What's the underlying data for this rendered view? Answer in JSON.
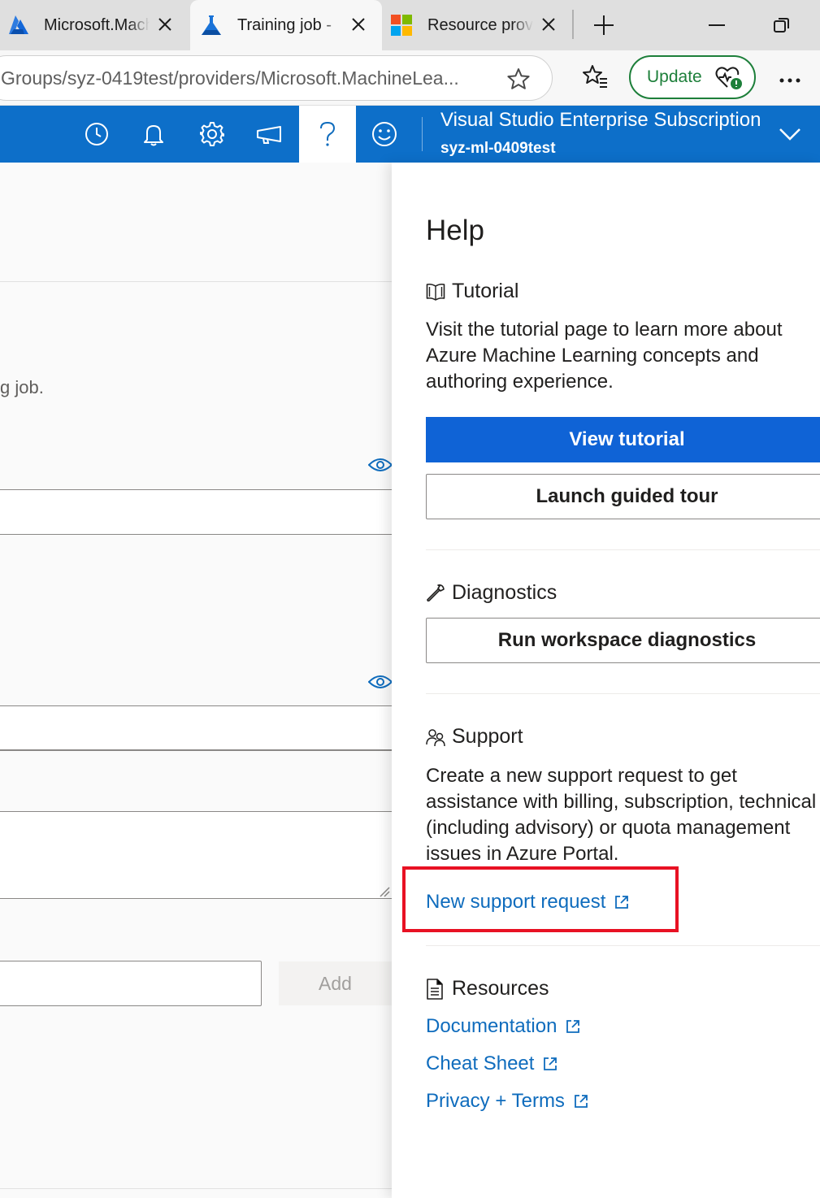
{
  "browser": {
    "tabs": [
      {
        "title": "Microsoft.Machine",
        "icon": "azure-icon",
        "active": false
      },
      {
        "title": "Training job - ",
        "icon": "azure-ml-flask-icon",
        "active": true
      },
      {
        "title": "Resource provid",
        "icon": "microsoft-logo-icon",
        "active": false
      }
    ],
    "url": "Groups/syz-0419test/providers/Microsoft.MachineLea...",
    "update_label": "Update"
  },
  "header": {
    "subscription_name": "Visual Studio Enterprise Subscription",
    "workspace_name": "syz-ml-0409test",
    "accent_color": "#0f6cbd"
  },
  "background_page": {
    "partial_text": "g job.",
    "add_label": "Add"
  },
  "help_panel": {
    "title": "Help",
    "tutorial": {
      "heading": "Tutorial",
      "description": "Visit the tutorial page to learn more about Azure Machine Learning concepts and authoring experience.",
      "view_button": "View tutorial",
      "tour_button": "Launch guided tour"
    },
    "diagnostics": {
      "heading": "Diagnostics",
      "button": "Run workspace diagnostics"
    },
    "support": {
      "heading": "Support",
      "description": "Create a new support request to get assistance with billing, subscription, technical (including advisory) or quota management issues in Azure Portal.",
      "link": "New support request"
    },
    "resources": {
      "heading": "Resources",
      "links": [
        "Documentation",
        "Cheat Sheet",
        "Privacy + Terms"
      ]
    }
  }
}
